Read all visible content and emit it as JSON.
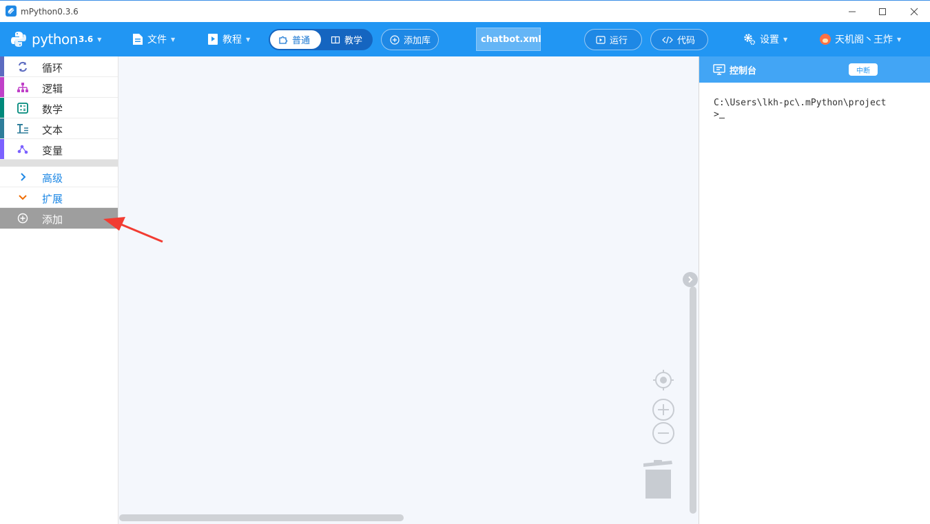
{
  "window": {
    "title": "mPython0.3.6",
    "controls": [
      "minimize",
      "maximize",
      "close"
    ]
  },
  "toolbar": {
    "logo_text": "python",
    "logo_version": "3.6",
    "file_menu": "文件",
    "tutorial_menu": "教程",
    "mode_normal": "普通",
    "mode_teaching": "教学",
    "add_library": "添加库",
    "current_file": "chatbot.xml",
    "run": "运行",
    "code": "代码",
    "settings": "设置",
    "user": "天机阁丶王炸",
    "colors": {
      "bar": "#2196f3",
      "accent": "#1565c0"
    }
  },
  "sidebar": {
    "categories": [
      {
        "label": "循环",
        "icon": "loop-icon",
        "color": "#5c6bc0"
      },
      {
        "label": "逻辑",
        "icon": "logic-tree-icon",
        "color": "#c040c8"
      },
      {
        "label": "数学",
        "icon": "calculator-icon",
        "color": "#00897b"
      },
      {
        "label": "文本",
        "icon": "text-icon",
        "color": "#2e7d9a"
      },
      {
        "label": "变量",
        "icon": "variable-icon",
        "color": "#7b61ff"
      }
    ],
    "advanced": "高级",
    "extension": "扩展",
    "add": "添加"
  },
  "console": {
    "title": "控制台",
    "stop_button": "中断",
    "path_line": "C:\\Users\\lkh-pc\\.mPython\\project",
    "prompt": ">"
  }
}
